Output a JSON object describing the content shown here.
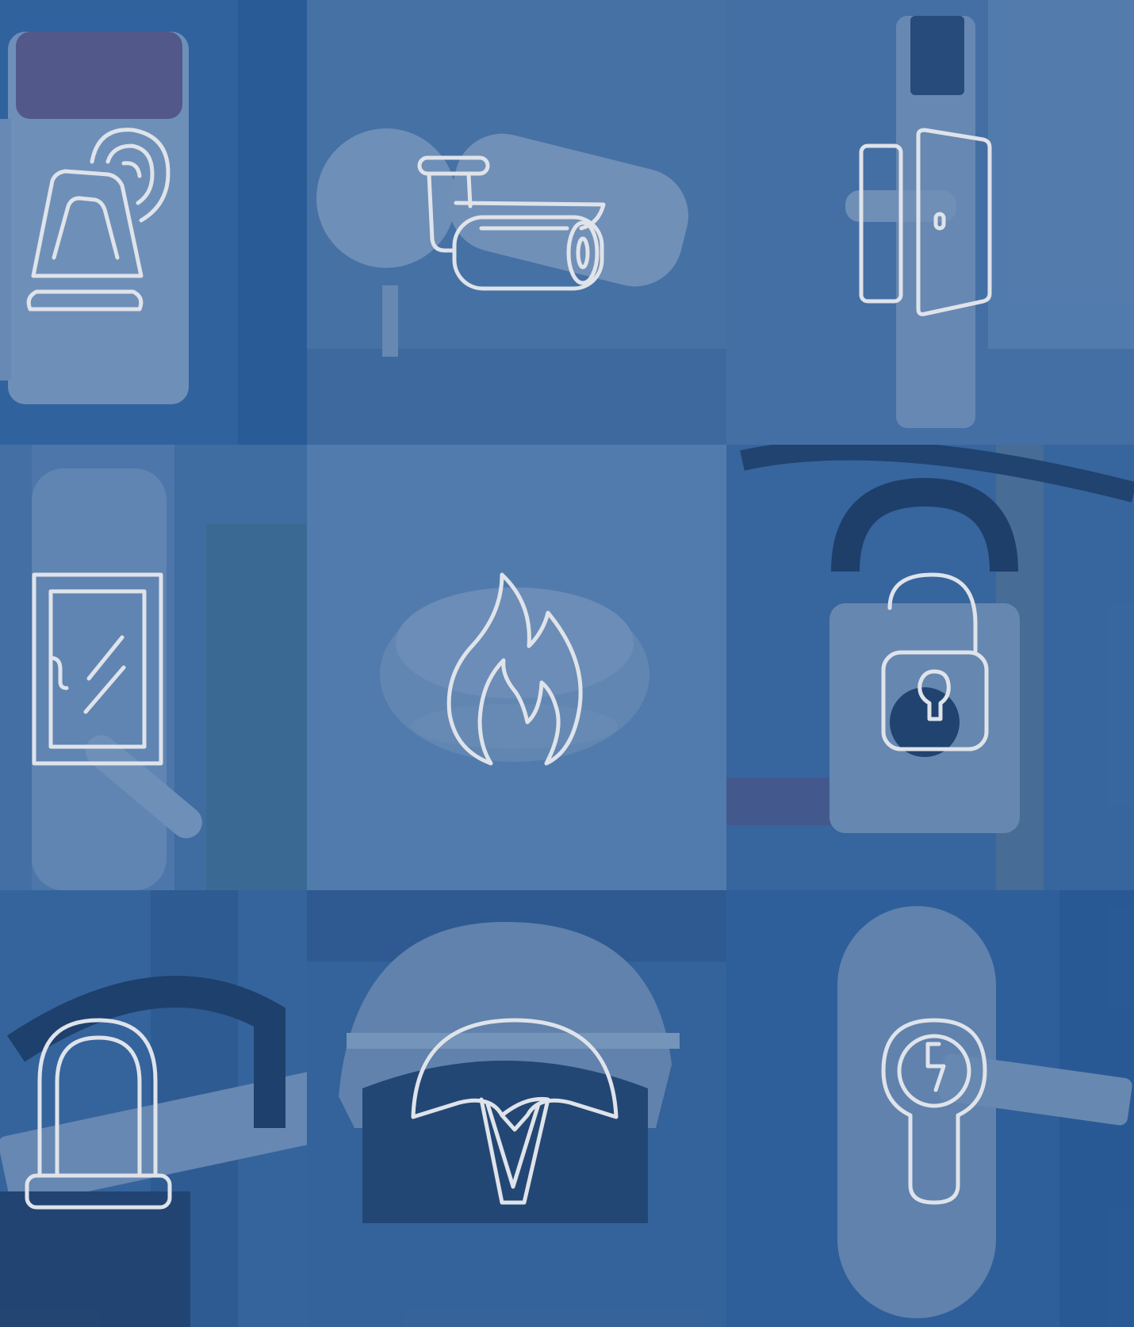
{
  "page": {
    "overlay_color": "#2b5d97",
    "icon_color": "#dfe3ea"
  },
  "tiles": [
    {
      "name": "alarm-siren-tile",
      "icon": "alarm-siren-icon",
      "photo_color": "#4b79ae"
    },
    {
      "name": "surveillance-camera-tile",
      "icon": "bullet-camera-icon",
      "photo_color": "#5f87b6"
    },
    {
      "name": "door-contact-tile",
      "icon": "door-sensor-icon",
      "photo_color": "#5a83b3"
    },
    {
      "name": "window-security-tile",
      "icon": "window-lock-icon",
      "photo_color": "#6a8fbc"
    },
    {
      "name": "smoke-detector-tile",
      "icon": "fire-icon",
      "photo_color": "#6b90bd"
    },
    {
      "name": "padlock-tile",
      "icon": "padlock-open-icon",
      "photo_color": "#3f6ea6"
    },
    {
      "name": "bike-lock-tile",
      "icon": "u-lock-icon",
      "photo_color": "#315f98"
    },
    {
      "name": "bike-helmet-tile",
      "icon": "helmet-icon",
      "photo_color": "#3b679f"
    },
    {
      "name": "door-cylinder-tile",
      "icon": "lock-cylinder-icon",
      "photo_color": "#34639b"
    }
  ]
}
